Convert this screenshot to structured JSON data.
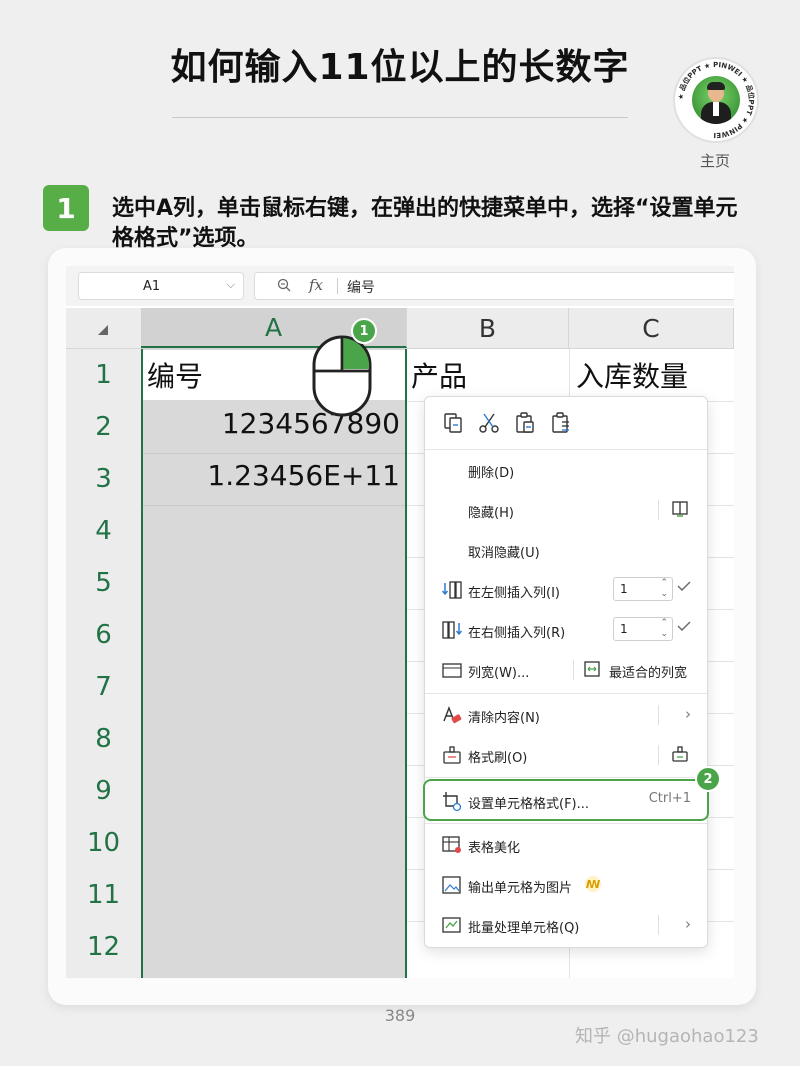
{
  "page": {
    "title": "如何输入11位以上的长数字",
    "home_label": "主页",
    "avatar_ring_text": "★ 品位PPT ★ PINWEI ★ 品位PPT ★ PINWEI",
    "page_number": "389",
    "watermark": "知乎 @hugaohao123"
  },
  "step": {
    "number": "1",
    "text": "选中A列，单击鼠标右键，在弹出的快捷菜单中，选择“设置单元格格式”选项。"
  },
  "spreadsheet": {
    "name_box": "A1",
    "fx_label": "fx",
    "formula_value": "编号",
    "columns": [
      "A",
      "B",
      "C"
    ],
    "rows": [
      "1",
      "2",
      "3",
      "4",
      "5",
      "6",
      "7",
      "8",
      "9",
      "10",
      "11",
      "12"
    ],
    "cells": {
      "A1": "编号",
      "A2": "1234567890",
      "A3": "1.23456E+11",
      "B1": "产品",
      "C1": "入库数量"
    },
    "markers": [
      "1",
      "2"
    ]
  },
  "context_menu": {
    "toolbar_icons": [
      "copy-icon",
      "cut-icon",
      "paste-icon",
      "paste-special-icon"
    ],
    "items": {
      "delete": "删除(D)",
      "hide": "隐藏(H)",
      "unhide": "取消隐藏(U)",
      "insert_left": "在左侧插入列(I)",
      "insert_left_count": "1",
      "insert_right": "在右侧插入列(R)",
      "insert_right_count": "1",
      "column_width": "列宽(W)...",
      "best_fit_width": "最适合的列宽",
      "clear_content": "清除内容(N)",
      "format_painter": "格式刷(O)",
      "format_cells": "设置单元格格式(F)...",
      "format_cells_shortcut": "Ctrl+1",
      "table_beautify": "表格美化",
      "export_image": "输出单元格为图片",
      "batch_process": "批量处理单元格(Q)"
    }
  },
  "colors": {
    "accent_green": "#57ae47",
    "excel_green": "#217346"
  }
}
